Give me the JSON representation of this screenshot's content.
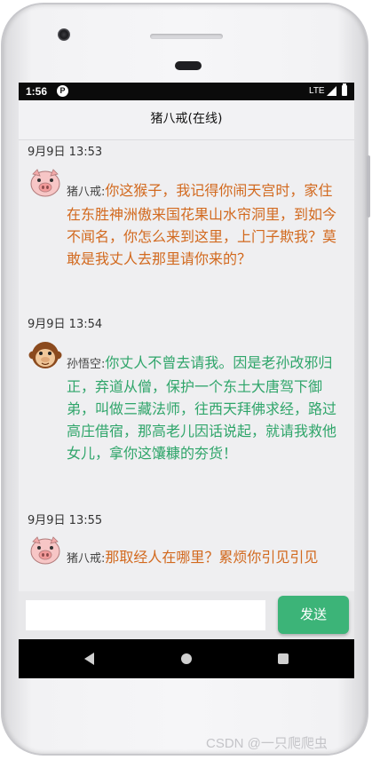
{
  "statusbar": {
    "time": "1:56",
    "app_icon": "P",
    "network": "LTE"
  },
  "appbar": {
    "title": "猪八戒(在线)"
  },
  "messages": [
    {
      "time": "9月9日 13:53",
      "sender": "猪八戒:",
      "avatar": "pig-avatar-icon",
      "text": "你这猴子，我记得你闹天宫时，家住在东胜神洲傲来国花果山水帘洞里，到如今不闻名，你怎么来到这里，上门子欺我？莫敢是我丈人去那里请你来的？"
    },
    {
      "time": "9月9日 13:54",
      "sender": "孙悟空:",
      "avatar": "monkey-avatar-icon",
      "text": "你丈人不曾去请我。因是老孙改邪归正，弃道从僧，保护一个东土大唐驾下御弟，叫做三藏法师，往西天拜佛求经，路过高庄借宿，那高老儿因话说起，就请我救他女儿，拿你这馕糠的夯货！"
    },
    {
      "time": "9月9日 13:55",
      "sender": "猪八戒:",
      "avatar": "pig-avatar-icon",
      "text": "那取经人在哪里？累烦你引见引见"
    }
  ],
  "input": {
    "value": "",
    "placeholder": ""
  },
  "send_button": {
    "label": "发送"
  },
  "colors": {
    "pig_text": "#d2691e",
    "monkey_text": "#2fa56a",
    "send_button": "#3cb478"
  },
  "watermark": "CSDN @一只爬爬虫"
}
